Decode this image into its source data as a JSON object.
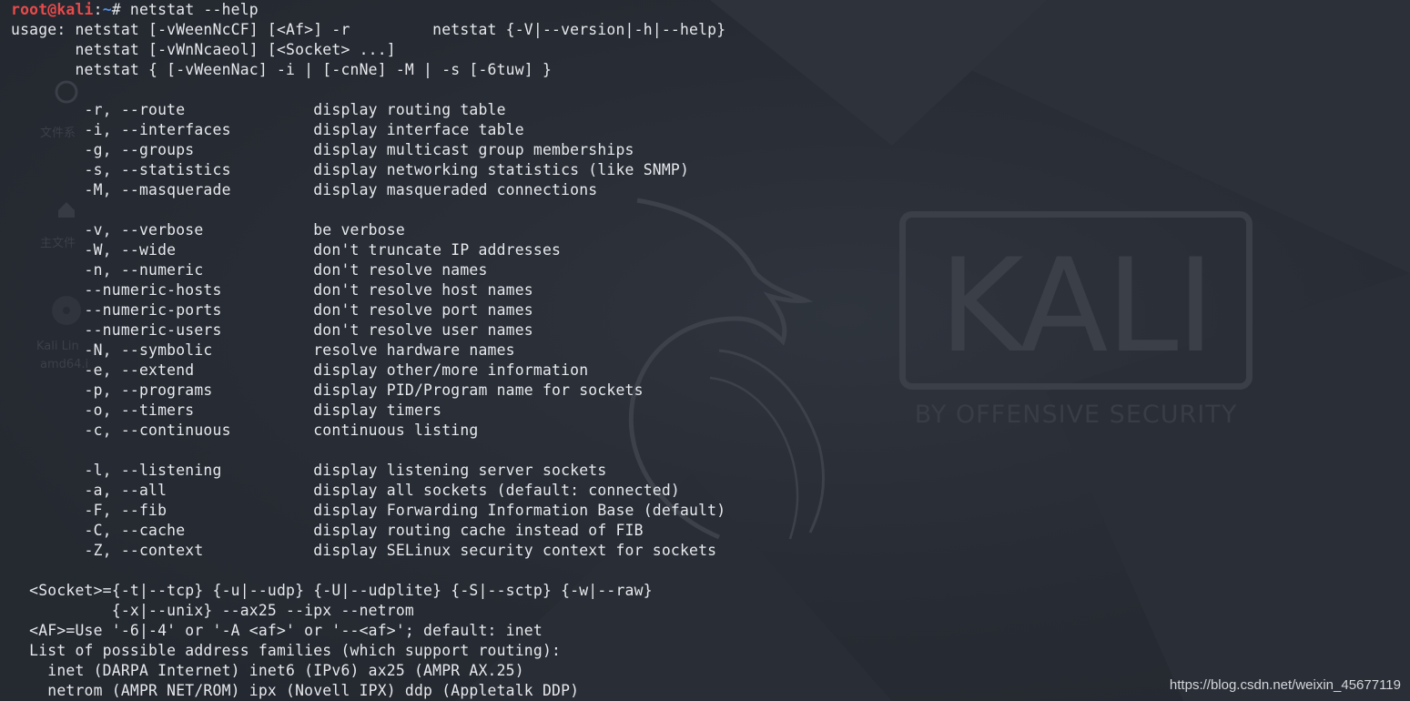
{
  "terminal": {
    "prompt_user": "root@kali",
    "prompt_sep": ":",
    "prompt_path": "~",
    "prompt_symbol": "# ",
    "command": "netstat --help",
    "lines": [
      "usage: netstat [-vWeenNcCF] [<Af>] -r         netstat {-V|--version|-h|--help}",
      "       netstat [-vWnNcaeol] [<Socket> ...]",
      "       netstat { [-vWeenNac] -i | [-cnNe] -M | -s [-6tuw] }",
      "",
      "        -r, --route              display routing table",
      "        -i, --interfaces         display interface table",
      "        -g, --groups             display multicast group memberships",
      "        -s, --statistics         display networking statistics (like SNMP)",
      "        -M, --masquerade         display masqueraded connections",
      "",
      "        -v, --verbose            be verbose",
      "        -W, --wide               don't truncate IP addresses",
      "        -n, --numeric            don't resolve names",
      "        --numeric-hosts          don't resolve host names",
      "        --numeric-ports          don't resolve port names",
      "        --numeric-users          don't resolve user names",
      "        -N, --symbolic           resolve hardware names",
      "        -e, --extend             display other/more information",
      "        -p, --programs           display PID/Program name for sockets",
      "        -o, --timers             display timers",
      "        -c, --continuous         continuous listing",
      "",
      "        -l, --listening          display listening server sockets",
      "        -a, --all                display all sockets (default: connected)",
      "        -F, --fib                display Forwarding Information Base (default)",
      "        -C, --cache              display routing cache instead of FIB",
      "        -Z, --context            display SELinux security context for sockets",
      "",
      "  <Socket>={-t|--tcp} {-u|--udp} {-U|--udplite} {-S|--sctp} {-w|--raw}",
      "           {-x|--unix} --ax25 --ipx --netrom",
      "  <AF>=Use '-6|-4' or '-A <af>' or '--<af>'; default: inet",
      "  List of possible address families (which support routing):",
      "    inet (DARPA Internet) inet6 (IPv6) ax25 (AMPR AX.25)",
      "    netrom (AMPR NET/ROM) ipx (Novell IPX) ddp (Appletalk DDP)"
    ]
  },
  "background": {
    "logo_text": "KALI",
    "logo_subtitle": "BY OFFENSIVE SECURITY",
    "desktop_labels": [
      "文件系",
      "主文件",
      "Kali Lin",
      "amd64.i"
    ]
  },
  "watermark": "https://blog.csdn.net/weixin_45677119",
  "colors": {
    "background": "#272b33",
    "prompt_user": "#e84a4a",
    "prompt_path": "#4f8fe8",
    "text": "#e6e8ec"
  }
}
